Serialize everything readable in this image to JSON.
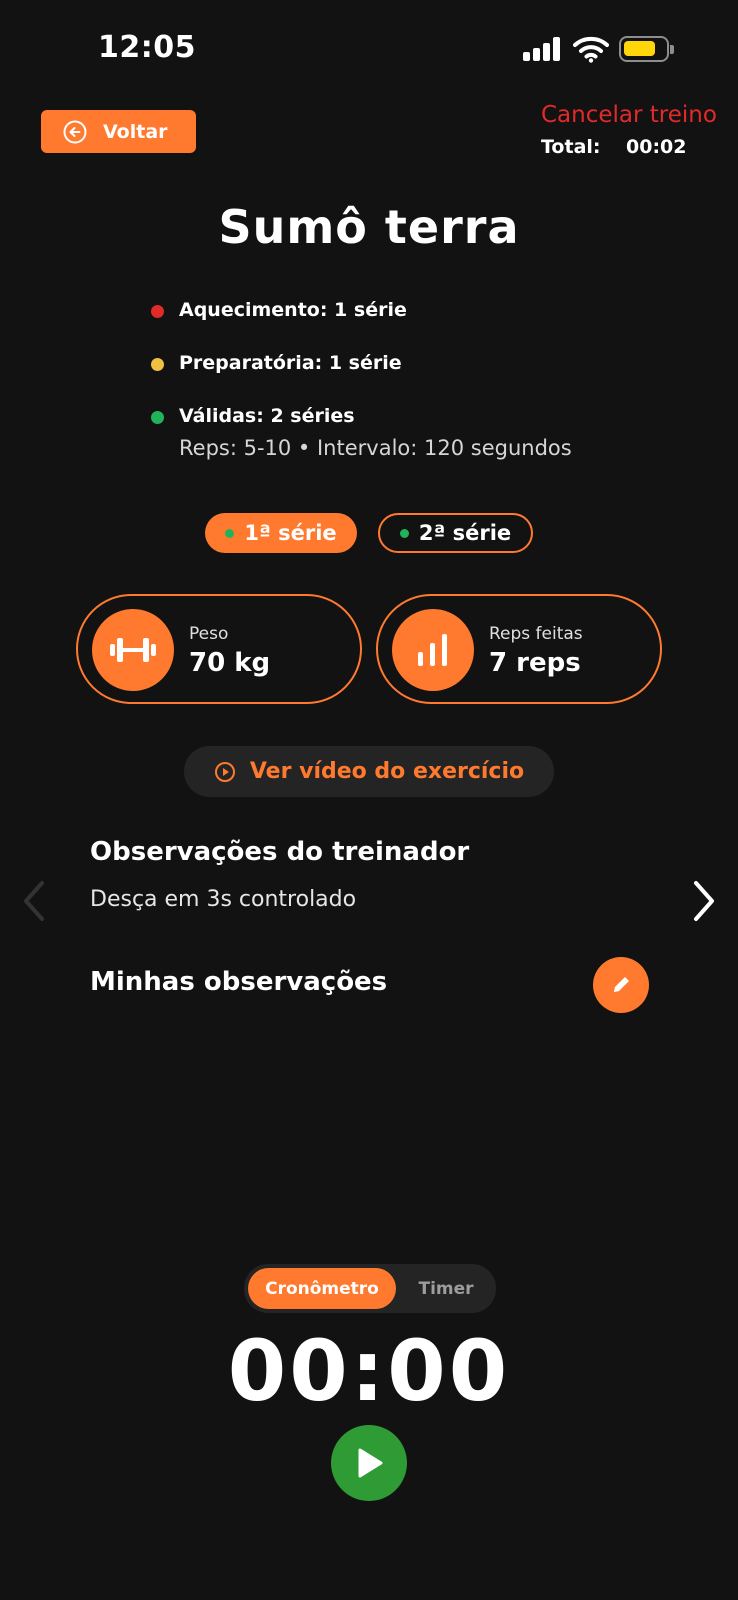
{
  "status_bar": {
    "time": "12:05"
  },
  "header": {
    "back_label": "Voltar",
    "cancel_label": "Cancelar treino",
    "total_label": "Total:",
    "total_value": "00:02"
  },
  "exercise": {
    "title": "Sumô terra",
    "sets": [
      {
        "label": "Aquecimento: 1 série",
        "color": "#e22a2a"
      },
      {
        "label": "Preparatória: 1 série",
        "color": "#f0c040"
      },
      {
        "label": "Válidas: 2 séries",
        "color": "#21b35a"
      }
    ],
    "details": "Reps: 5-10 • Intervalo: 120 segundos"
  },
  "series_tabs": [
    {
      "label": "1ª série",
      "active": true
    },
    {
      "label": "2ª série",
      "active": false
    }
  ],
  "stats": {
    "weight_label": "Peso",
    "weight_value": "70 kg",
    "reps_label": "Reps feitas",
    "reps_value": "7 reps"
  },
  "video_label": "Ver vídeo do exercício",
  "notes": {
    "coach_title": "Observações do treinador",
    "coach_text": "Desça em 3s controlado",
    "mine_title": "Minhas observações"
  },
  "timer": {
    "mode_stopwatch": "Cronômetro",
    "mode_timer": "Timer",
    "display": "00:00"
  },
  "colors": {
    "accent": "#ff7a2f",
    "background": "#121212",
    "danger": "#e22a2a",
    "play": "#2e9b34"
  },
  "icons": [
    "arrow-left-circle-icon",
    "dumbbell-icon",
    "bar-chart-icon",
    "play-circle-icon",
    "chevron-left-icon",
    "chevron-right-icon",
    "pencil-icon",
    "play-icon",
    "wifi-icon",
    "signal-icon",
    "battery-icon"
  ]
}
